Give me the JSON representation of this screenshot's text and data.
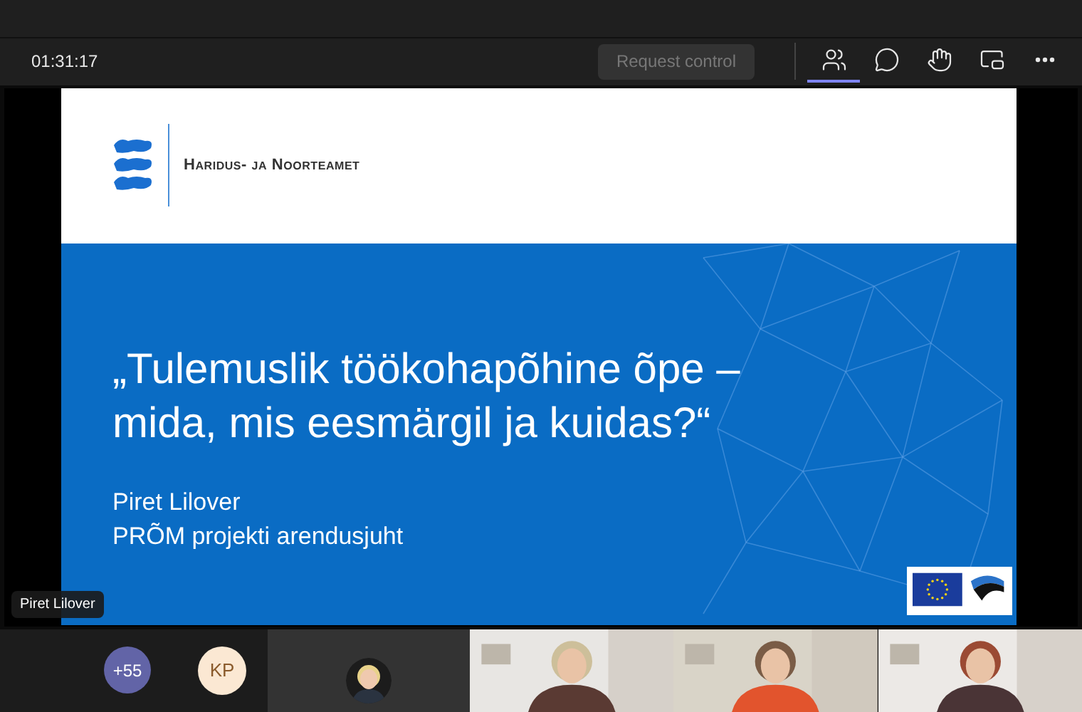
{
  "call": {
    "timer": "01:31:17",
    "request_control": {
      "label": "Request control",
      "disabled": true
    },
    "toolbar": [
      {
        "kind": "participants",
        "selected": true
      },
      {
        "kind": "chat",
        "selected": false
      },
      {
        "kind": "reactions",
        "selected": false
      },
      {
        "kind": "share",
        "selected": false
      },
      {
        "kind": "more",
        "selected": false
      }
    ]
  },
  "slide": {
    "org": "Haridus- ja Noorteamet",
    "title_lines": [
      "„Tulemuslik töökohapõhine õpe –",
      "mida, mis eesmärgil ja kuidas?“"
    ],
    "presenter": "Piret Lilover",
    "role": "PRÕM projekti arendusjuht"
  },
  "name_tag": "Piret Lilover",
  "participants": [
    {
      "kind": "overflow",
      "label": "+55"
    },
    {
      "kind": "initials",
      "label": "KP"
    }
  ],
  "tiles": [
    {
      "kind": "avatar"
    },
    {
      "kind": "video"
    },
    {
      "kind": "video"
    },
    {
      "kind": "video"
    }
  ]
}
